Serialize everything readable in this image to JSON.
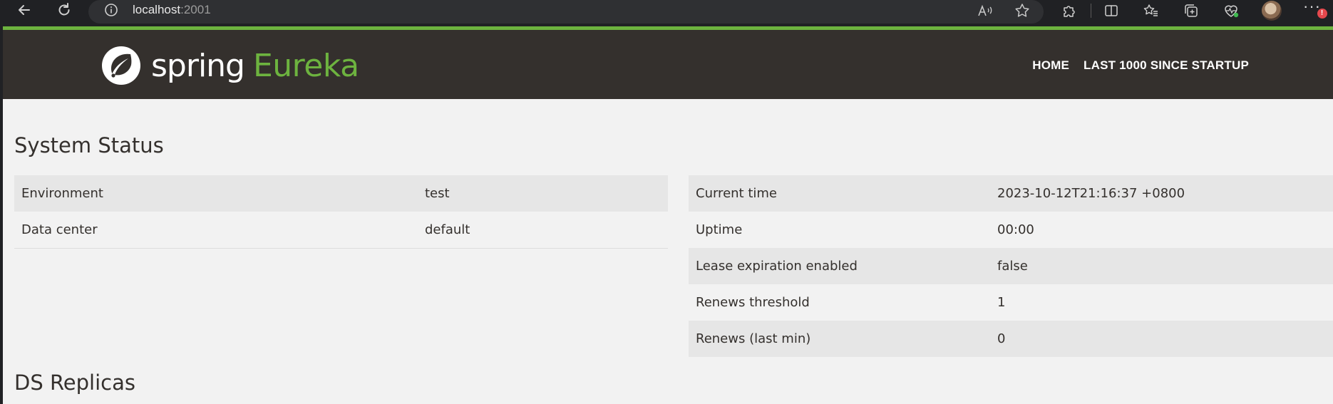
{
  "browser": {
    "url_host": "localhost",
    "url_port": ":2001",
    "icons": [
      "back-arrow-icon",
      "refresh-icon",
      "info-icon",
      "read-aloud-icon",
      "favorite-star-icon",
      "extensions-icon",
      "split-screen-icon",
      "favorites-icon",
      "collections-icon",
      "browser-essentials-icon",
      "more-icon"
    ]
  },
  "navbar": {
    "brand_spring": "spring",
    "brand_eureka": "Eureka",
    "links": [
      "HOME",
      "LAST 1000 SINCE STARTUP"
    ]
  },
  "system_status": {
    "title": "System Status",
    "left": [
      {
        "key": "Environment",
        "value": "test"
      },
      {
        "key": "Data center",
        "value": "default"
      }
    ],
    "right": [
      {
        "key": "Current time",
        "value": "2023-10-12T21:16:37 +0800"
      },
      {
        "key": "Uptime",
        "value": "00:00"
      },
      {
        "key": "Lease expiration enabled",
        "value": "false"
      },
      {
        "key": "Renews threshold",
        "value": "1"
      },
      {
        "key": "Renews (last min)",
        "value": "0"
      }
    ]
  },
  "ds_replicas": {
    "title": "DS Replicas"
  },
  "colors": {
    "brand_green": "#6db33f",
    "navbar_bg": "#34302d",
    "page_bg": "#f2f2f2"
  }
}
